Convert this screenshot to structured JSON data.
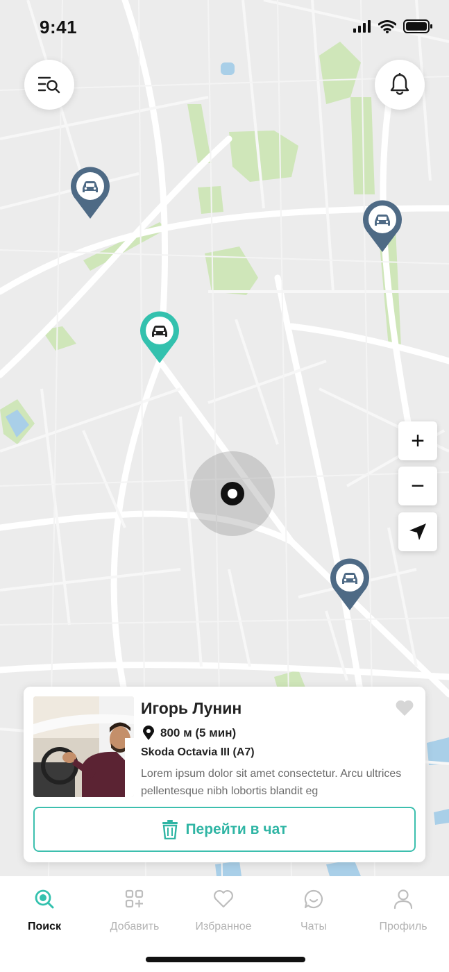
{
  "status_bar": {
    "time": "9:41"
  },
  "top_buttons": {
    "filter_icon": "search-list-icon",
    "bell_icon": "bell-icon"
  },
  "markers": [
    {
      "icon": "car-icon",
      "color": "#4e6a85",
      "active": false
    },
    {
      "icon": "car-icon",
      "color": "#4e6a85",
      "active": false
    },
    {
      "icon": "car-icon",
      "color": "#33c1ae",
      "active": true
    },
    {
      "icon": "car-icon",
      "color": "#4e6a85",
      "active": false
    }
  ],
  "map_controls": {
    "zoom_in": "+",
    "zoom_out": "−",
    "locate_icon": "navigation-arrow-icon"
  },
  "driver_card": {
    "name": "Игорь Лунин",
    "distance": "800 м (5 мин)",
    "car": "Skoda Octavia III (A7)",
    "description": "Lorem ipsum dolor sit amet consectetur. Arcu ultrices pellentesque nibh lobortis blandit eg",
    "chat_button": "Перейти в чат",
    "favorite_icon": "heart-icon"
  },
  "bottom_nav": [
    {
      "label": "Поиск",
      "icon": "search-icon",
      "active": true
    },
    {
      "label": "Добавить",
      "icon": "add-grid-icon",
      "active": false
    },
    {
      "label": "Избранное",
      "icon": "heart-icon",
      "active": false
    },
    {
      "label": "Чаты",
      "icon": "chat-icon",
      "active": false
    },
    {
      "label": "Профиль",
      "icon": "user-icon",
      "active": false
    }
  ],
  "colors": {
    "accent": "#33c1ae",
    "marker": "#4e6a85",
    "text": "#222222",
    "muted": "#b3b3b3"
  }
}
